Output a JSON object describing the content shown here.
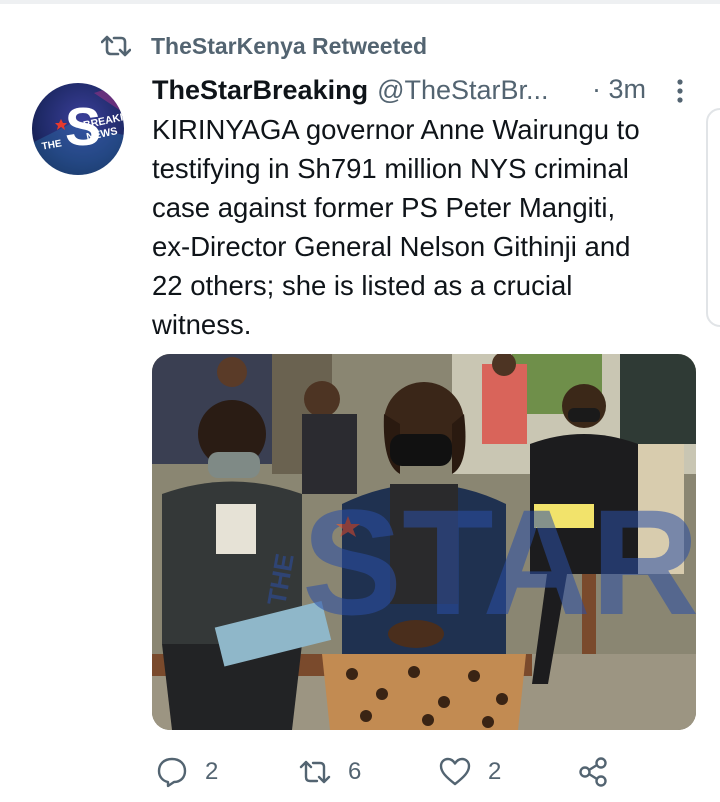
{
  "retweet_banner": {
    "icon": "retweet-icon",
    "text": "TheStarKenya Retweeted"
  },
  "tweet": {
    "display_name": "TheStarBreaking",
    "handle": "@TheStarBr...",
    "time": "· 3m",
    "text": "KIRINYAGA governor Anne Wairungu to\ntestifying in Sh791 million NYS criminal\ncase against former PS Peter Mangiti,\nex-Director General Nelson Githinji and\n22 others; she is listed as a crucial\nwitness.",
    "avatar": {
      "logo_letter": "S",
      "logo_small": "THE",
      "logo_lines": [
        "BREAKING",
        "NEWS"
      ]
    },
    "media": {
      "watermark": "STAR",
      "watermark_small": "THE"
    },
    "actions": {
      "reply": {
        "icon": "reply-icon",
        "count": "2"
      },
      "retweet": {
        "icon": "retweet-icon",
        "count": "6"
      },
      "like": {
        "icon": "heart-icon",
        "count": "2"
      },
      "share": {
        "icon": "share-icon"
      }
    }
  },
  "colors": {
    "secondary_text": "#536471",
    "primary_text": "#0f1419",
    "avatar_bg": "#1f2a68"
  }
}
